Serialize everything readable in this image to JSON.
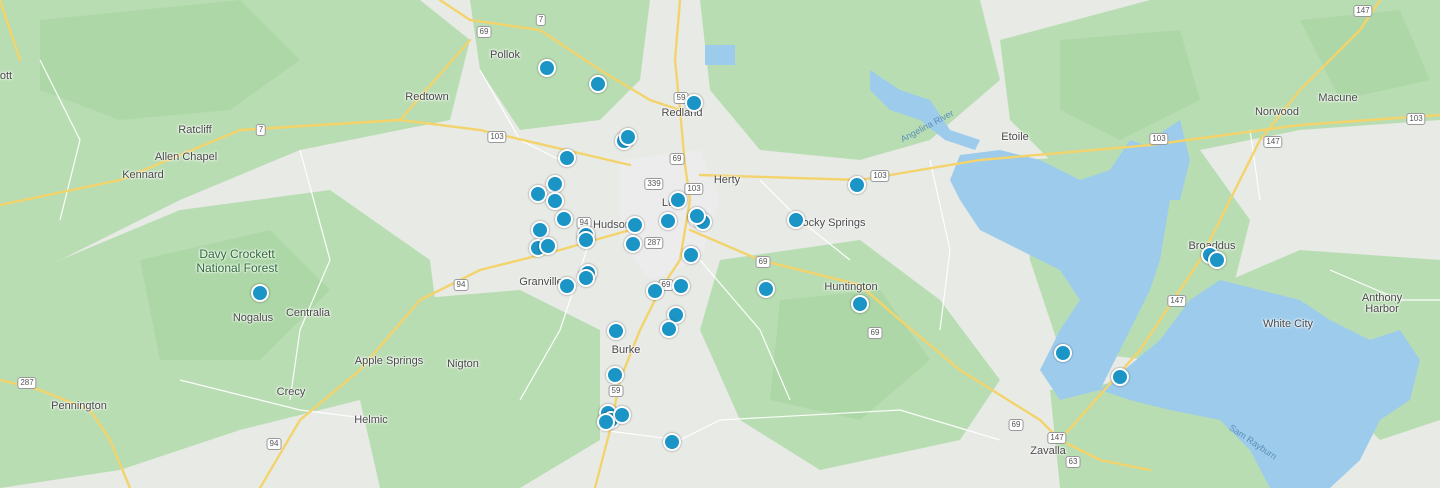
{
  "map": {
    "places": [
      {
        "id": "pollok",
        "name": "Pollok"
      },
      {
        "id": "redtown",
        "name": "Redtown"
      },
      {
        "id": "ratcliff",
        "name": "Ratcliff"
      },
      {
        "id": "allen-chapel",
        "name": "Allen Chapel"
      },
      {
        "id": "kennard",
        "name": "Kennard"
      },
      {
        "id": "redland",
        "name": "Redland"
      },
      {
        "id": "herty",
        "name": "Herty"
      },
      {
        "id": "lufkin",
        "name": "Lu"
      },
      {
        "id": "hudson",
        "name": "Hudson"
      },
      {
        "id": "granville",
        "name": "Granville"
      },
      {
        "id": "burke",
        "name": "Burke"
      },
      {
        "id": "rocky-springs",
        "name": "Rocky Springs"
      },
      {
        "id": "huntington",
        "name": "Huntington"
      },
      {
        "id": "etoile",
        "name": "Etoile"
      },
      {
        "id": "norwood",
        "name": "Norwood"
      },
      {
        "id": "macune",
        "name": "Macune"
      },
      {
        "id": "broaddus",
        "name": "Broaddus"
      },
      {
        "id": "anthony",
        "name": "Anthony"
      },
      {
        "id": "harbor",
        "name": "Harbor"
      },
      {
        "id": "white-city",
        "name": "White City"
      },
      {
        "id": "zavalla",
        "name": "Zavalla"
      },
      {
        "id": "nogalus",
        "name": "Nogalus"
      },
      {
        "id": "centralia",
        "name": "Centralia"
      },
      {
        "id": "apple-springs",
        "name": "Apple Springs"
      },
      {
        "id": "nigton",
        "name": "Nigton"
      },
      {
        "id": "crecy",
        "name": "Crecy"
      },
      {
        "id": "helmic",
        "name": "Helmic"
      },
      {
        "id": "pennington",
        "name": "Pennington"
      },
      {
        "id": "edge-ott",
        "name": "ott"
      }
    ],
    "forest_label": [
      "Davy Crockett",
      "National Forest"
    ],
    "water_labels": [
      {
        "id": "angelina-river",
        "name": "Angelina River"
      },
      {
        "id": "sam-rayburn",
        "name": "Sam Rayburn"
      }
    ],
    "highway_shields": [
      {
        "id": "s69a",
        "name": "69"
      },
      {
        "id": "s7a",
        "name": "7"
      },
      {
        "id": "s7b",
        "name": "7"
      },
      {
        "id": "s103a",
        "name": "103"
      },
      {
        "id": "s59a",
        "name": "59"
      },
      {
        "id": "s69b",
        "name": "69"
      },
      {
        "id": "s339",
        "name": "339"
      },
      {
        "id": "s103b",
        "name": "103"
      },
      {
        "id": "s94a",
        "name": "94"
      },
      {
        "id": "s287a",
        "name": "287"
      },
      {
        "id": "s69c",
        "name": "69"
      },
      {
        "id": "s69d",
        "name": "69"
      },
      {
        "id": "s103c",
        "name": "103"
      },
      {
        "id": "s69e",
        "name": "69"
      },
      {
        "id": "s94b",
        "name": "94"
      },
      {
        "id": "s59b",
        "name": "59"
      },
      {
        "id": "s287b",
        "name": "287"
      },
      {
        "id": "s94c",
        "name": "94"
      },
      {
        "id": "s69f",
        "name": "69"
      },
      {
        "id": "s147a",
        "name": "147"
      },
      {
        "id": "s147b",
        "name": "147"
      },
      {
        "id": "s147c",
        "name": "147"
      },
      {
        "id": "s103d",
        "name": "103"
      },
      {
        "id": "s103e",
        "name": "103"
      },
      {
        "id": "s147d",
        "name": "147"
      },
      {
        "id": "s63",
        "name": "63"
      }
    ],
    "marker_count": 46,
    "colors": {
      "marker": "#1b94c6",
      "water": "#9ccbec",
      "forest": "#b7dcb1",
      "road": "#f3d36b",
      "land": "#e8eae6"
    }
  }
}
